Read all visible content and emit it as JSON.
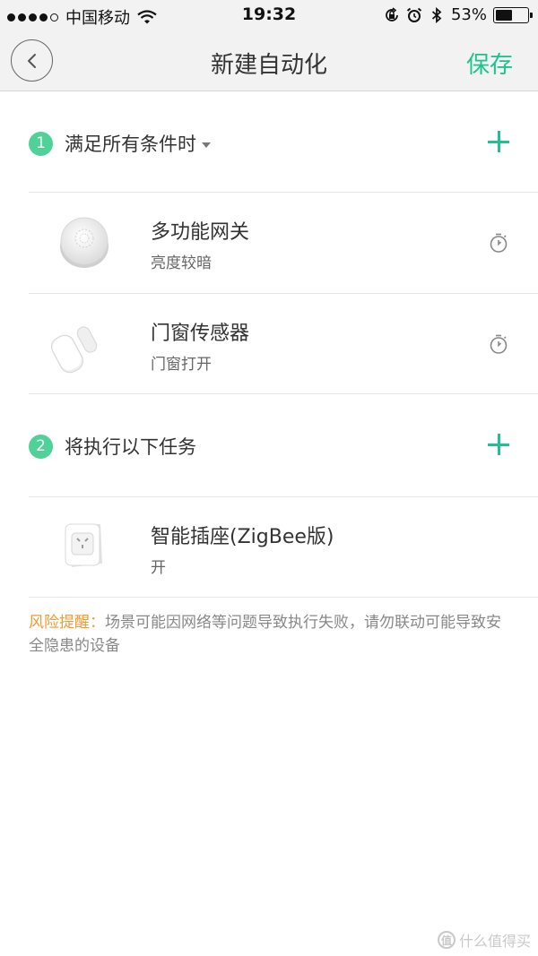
{
  "status_bar": {
    "carrier": "中国移动",
    "time": "19:32",
    "battery_percent": "53%",
    "battery_level": 0.53,
    "signal_bars_filled": 4,
    "signal_bars_total": 5,
    "icons": [
      "wifi-icon",
      "orientation-lock-icon",
      "alarm-icon",
      "bluetooth-icon",
      "battery-icon"
    ]
  },
  "nav": {
    "title": "新建自动化",
    "save_label": "保存",
    "back_icon": "chevron-left-icon"
  },
  "conditions": {
    "step": "1",
    "title": "满足所有条件时",
    "devices": [
      {
        "name": "多功能网关",
        "state": "亮度较暗",
        "icon": "gateway-device-icon"
      },
      {
        "name": "门窗传感器",
        "state": "门窗打开",
        "icon": "door-sensor-device-icon"
      }
    ]
  },
  "actions": {
    "step": "2",
    "title": "将执行以下任务",
    "devices": [
      {
        "name": "智能插座(ZigBee版)",
        "state": "开",
        "icon": "smart-plug-device-icon"
      }
    ]
  },
  "warning": {
    "label": "风险提醒：",
    "text": "场景可能因网络等问题导致执行失败，请勿联动可能导致安全隐患的设备"
  },
  "watermark": {
    "logo": "值",
    "text": "什么值得买"
  },
  "colors": {
    "accent": "#1ec48e",
    "step_circle": "#4fd197",
    "warning_label": "#f39a34",
    "nav_background": "#f2f2f2"
  }
}
